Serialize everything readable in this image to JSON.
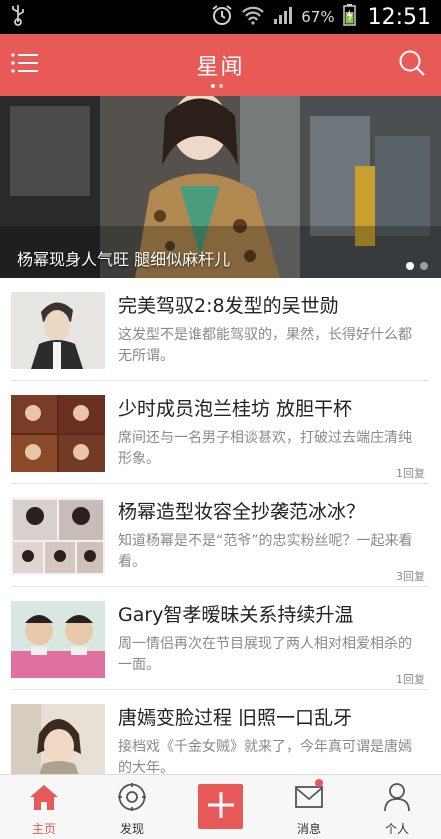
{
  "status_bar": {
    "battery_percent": "67%",
    "time": "12:51"
  },
  "app_bar": {
    "title": "星闻",
    "menu_icon": "menu-icon",
    "search_icon": "search-icon"
  },
  "banner": {
    "caption": "杨幂现身人气旺 腿细似麻杆儿"
  },
  "news": [
    {
      "title": "完美驾驭2:8发型的吴世勋",
      "desc": "这发型不是谁都能驾驭的，果然，长得好什么都无所谓。",
      "reply": ""
    },
    {
      "title": "少时成员泡兰桂坊 放胆干杯",
      "desc": "席间还与一名男子相谈甚欢，打破过去端庄清纯形象。",
      "reply": "1回复"
    },
    {
      "title": "杨幂造型妆容全抄袭范冰冰？",
      "desc": "知道杨幂是不是“范爷”的忠实粉丝呢？一起来看看。",
      "reply": "3回复"
    },
    {
      "title": "Gary智孝暧昧关系持续升温",
      "desc": "周一情侣再次在节目展现了两人相对相爱相杀的一面。",
      "reply": "1回复"
    },
    {
      "title": "唐嫣变脸过程 旧照一口乱牙",
      "desc": "接档戏《千金女贼》就来了，今年真可谓是唐嫣的大年。",
      "reply": ""
    }
  ],
  "bottom_nav": {
    "home": "主页",
    "discover": "发现",
    "messages": "消息",
    "profile": "个人"
  },
  "colors": {
    "accent": "#e85a58",
    "status_bar": "#000000"
  }
}
